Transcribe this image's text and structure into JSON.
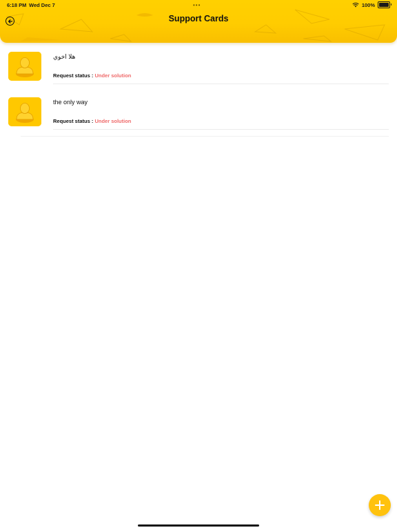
{
  "status_bar": {
    "time": "6:18 PM",
    "date": "Wed Dec 7",
    "dots": "•••",
    "battery_text": "100%",
    "battery_level": 1.0
  },
  "header": {
    "title": "Support Cards",
    "back_icon": "arrow-left-circle-icon",
    "background_color": "#ffcc00"
  },
  "cards": [
    {
      "title": "هلا اخوي",
      "status_label": "Request status :",
      "status_value": "Under solution"
    },
    {
      "title": "the only way",
      "status_label": "Request status :",
      "status_value": "Under solution"
    }
  ],
  "colors": {
    "accent": "#ffc800",
    "status_value": "#ef6b6b"
  },
  "fab": {
    "icon": "plus-icon",
    "color": "#ffc20e"
  }
}
